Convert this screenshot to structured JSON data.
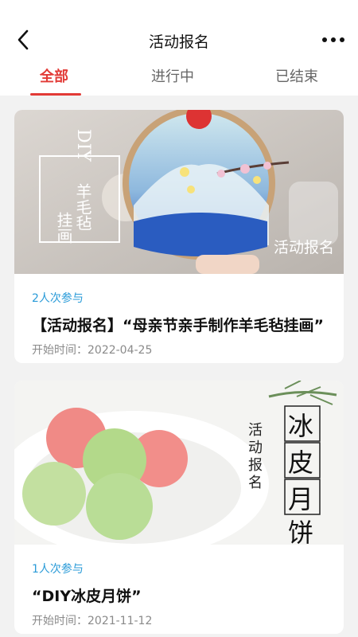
{
  "header": {
    "title": "活动报名",
    "back_icon": "chevron-left-icon",
    "more_icon": "more-horizontal-icon"
  },
  "tabs": [
    {
      "label": "全部",
      "active": true
    },
    {
      "label": "进行中",
      "active": false
    },
    {
      "label": "已结束",
      "active": false
    }
  ],
  "colors": {
    "accent": "#e23a36",
    "participants": "#2a9bd8"
  },
  "activities": [
    {
      "participants": "2人次参与",
      "title": "【活动报名】“母亲节亲手制作羊毛毡挂画”",
      "start_label": "开始时间：",
      "start_date": "2022-04-25",
      "image": {
        "tag": "活动报名",
        "vertical_text_1": "DIY",
        "vertical_text_2": "羊毛毡",
        "vertical_text_3": "挂画"
      }
    },
    {
      "participants": "1人次参与",
      "title": "“DIY冰皮月饼”",
      "start_label": "开始时间：",
      "start_date": "2021-11-12",
      "image": {
        "tag": "活动报名",
        "big_chars": [
          "冰",
          "皮",
          "月",
          "饼"
        ]
      }
    }
  ]
}
